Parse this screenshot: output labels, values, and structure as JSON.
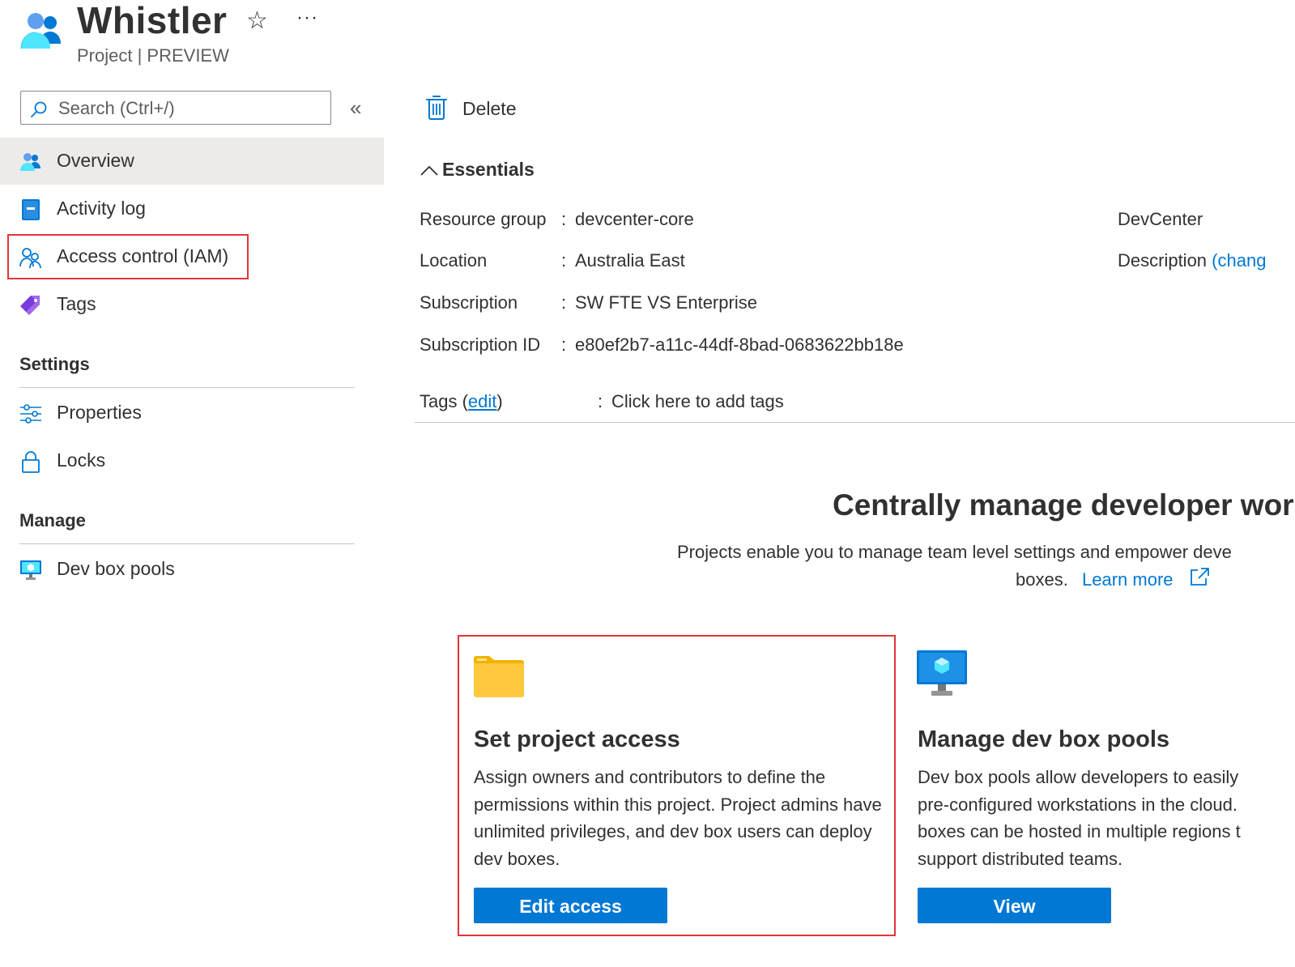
{
  "header": {
    "title": "Whistler",
    "subtitle": "Project | PREVIEW",
    "favorite_glyph": "☆",
    "more_glyph": "···"
  },
  "search": {
    "placeholder": "Search (Ctrl+/)",
    "collapse_glyph": "«"
  },
  "sidebar": {
    "items": [
      {
        "label": "Overview",
        "icon": "people-icon",
        "selected": true
      },
      {
        "label": "Activity log",
        "icon": "activity-log-icon"
      },
      {
        "label": "Access control (IAM)",
        "icon": "people-outline-icon",
        "highlighted": true
      },
      {
        "label": "Tags",
        "icon": "tag-icon"
      }
    ],
    "sections": [
      {
        "title": "Settings",
        "items": [
          {
            "label": "Properties",
            "icon": "sliders-icon"
          },
          {
            "label": "Locks",
            "icon": "lock-icon"
          }
        ]
      },
      {
        "title": "Manage",
        "items": [
          {
            "label": "Dev box pools",
            "icon": "monitor-icon"
          }
        ]
      }
    ]
  },
  "toolbar": {
    "delete_label": "Delete"
  },
  "essentials": {
    "toggle_label": "Essentials",
    "fields": [
      {
        "key": "Resource group",
        "value": "devcenter-core",
        "link": true
      },
      {
        "key": "Location",
        "value": "Australia East",
        "link": false
      },
      {
        "key": "Subscription",
        "value": "SW FTE VS Enterprise",
        "link": true
      },
      {
        "key": "Subscription ID",
        "value": "e80ef2b7-a11c-44df-8bad-0683622bb18e",
        "link": false
      }
    ],
    "right_fields": [
      {
        "key": "DevCenter"
      },
      {
        "key": "Description",
        "value": "(chang"
      }
    ],
    "tags": {
      "key_prefix": "Tags (",
      "edit": "edit",
      "key_suffix": ")",
      "value": "Click here to add tags"
    },
    "colon": ":"
  },
  "hero": {
    "title": "Centrally manage developer wor",
    "description_line1": "Projects enable you to manage team level settings and empower deve",
    "description_line2": "boxes.",
    "learn_more": "Learn more"
  },
  "cards": [
    {
      "title": "Set project access",
      "description": "Assign owners and contributors to define the permissions within this project. Project admins have unlimited privileges, and dev box users can deploy dev boxes.",
      "button": "Edit access",
      "icon": "folder-icon"
    },
    {
      "title": "Manage dev box pools",
      "description": "Dev box pools allow developers to easily pre-configured workstations in the cloud. boxes can be hosted in multiple regions t support distributed teams.",
      "button": "View",
      "icon": "monitor-icon"
    }
  ],
  "colors": {
    "accent": "#0078d4",
    "highlight": "#e0353a",
    "selected_bg": "#edebe9",
    "folder": "#ffc83d"
  }
}
